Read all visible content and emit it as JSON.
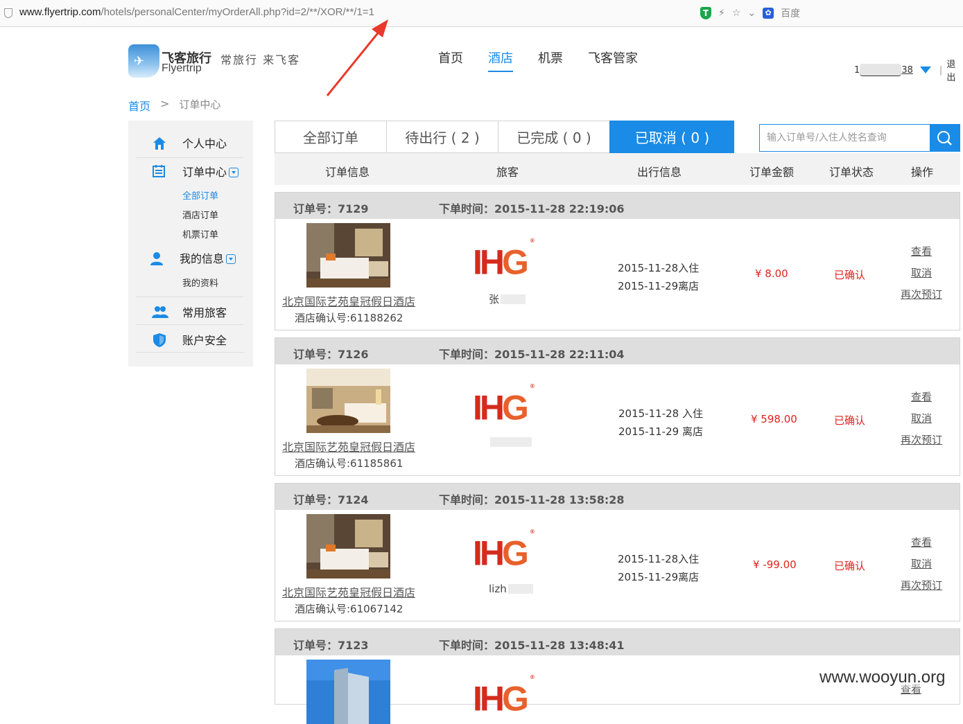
{
  "browser": {
    "url_host": "www.flyertrip.com",
    "url_path": "/hotels/personalCenter/myOrderAll.php?id=2/**/XOR/**/1=1",
    "search_engine": "百度"
  },
  "site": {
    "brand_cn": "飞客旅行",
    "brand_en": "Flyertrip",
    "slogan": "常旅行 来飞客",
    "nav": [
      "首页",
      "酒店",
      "机票",
      "飞客管家"
    ],
    "nav_active": "酒店",
    "user_id_prefix": "1",
    "user_id_suffix": "38",
    "logout": "退出"
  },
  "breadcrumb": {
    "home": "首页",
    "sep": ">",
    "current": "订单中心"
  },
  "sidebar": {
    "personal_center": "个人中心",
    "order_center": "订单中心",
    "order_sub": [
      "全部订单",
      "酒店订单",
      "机票订单"
    ],
    "my_info": "我的信息",
    "my_info_sub": [
      "我的资料"
    ],
    "frequent_travelers": "常用旅客",
    "account_security": "账户安全"
  },
  "tabs": [
    "全部订单",
    "待出行 ( 2 )",
    "已完成 ( 0 )",
    "已取消 ( 0 )"
  ],
  "search": {
    "placeholder": "输入订单号/入住人姓名查询"
  },
  "columns": [
    "订单信息",
    "旅客",
    "出行信息",
    "订单金额",
    "订单状态",
    "操作"
  ],
  "orders": [
    {
      "no_label": "订单号：7129",
      "time_label": "下单时间：2015-11-28 22:19:06",
      "hotel": "北京国际艺苑皇冠假日酒店",
      "confirm": "酒店确认号:61188262",
      "guest": "张",
      "checkin": "2015-11-28入住",
      "checkout": "2015-11-29离店",
      "amount": "¥ 8.00",
      "status": "已确认",
      "ops": [
        "查看",
        "取消",
        "再次预订"
      ]
    },
    {
      "no_label": "订单号：7126",
      "time_label": "下单时间：2015-11-28 22:11:04",
      "hotel": "北京国际艺苑皇冠假日酒店",
      "confirm": "酒店确认号:61185861",
      "guest": "",
      "checkin": "2015-11-28 入住",
      "checkout": "2015-11-29 离店",
      "amount": "¥ 598.00",
      "status": "已确认",
      "ops": [
        "查看",
        "取消",
        "再次预订"
      ]
    },
    {
      "no_label": "订单号：7124",
      "time_label": "下单时间：2015-11-28 13:58:28",
      "hotel": "北京国际艺苑皇冠假日酒店",
      "confirm": "酒店确认号:61067142",
      "guest": "lizh",
      "checkin": "2015-11-28入住",
      "checkout": "2015-11-29离店",
      "amount": "¥ -99.00",
      "status": "已确认",
      "ops": [
        "查看",
        "取消",
        "再次预订"
      ]
    },
    {
      "no_label": "订单号：7123",
      "time_label": "下单时间：2015-11-28 13:48:41",
      "ops": [
        "查看"
      ]
    }
  ],
  "watermark": "www.wooyun.org",
  "colors": {
    "accent": "#1a8be6",
    "status_red": "#e0231c",
    "annotation_arrow": "#e8392c"
  }
}
